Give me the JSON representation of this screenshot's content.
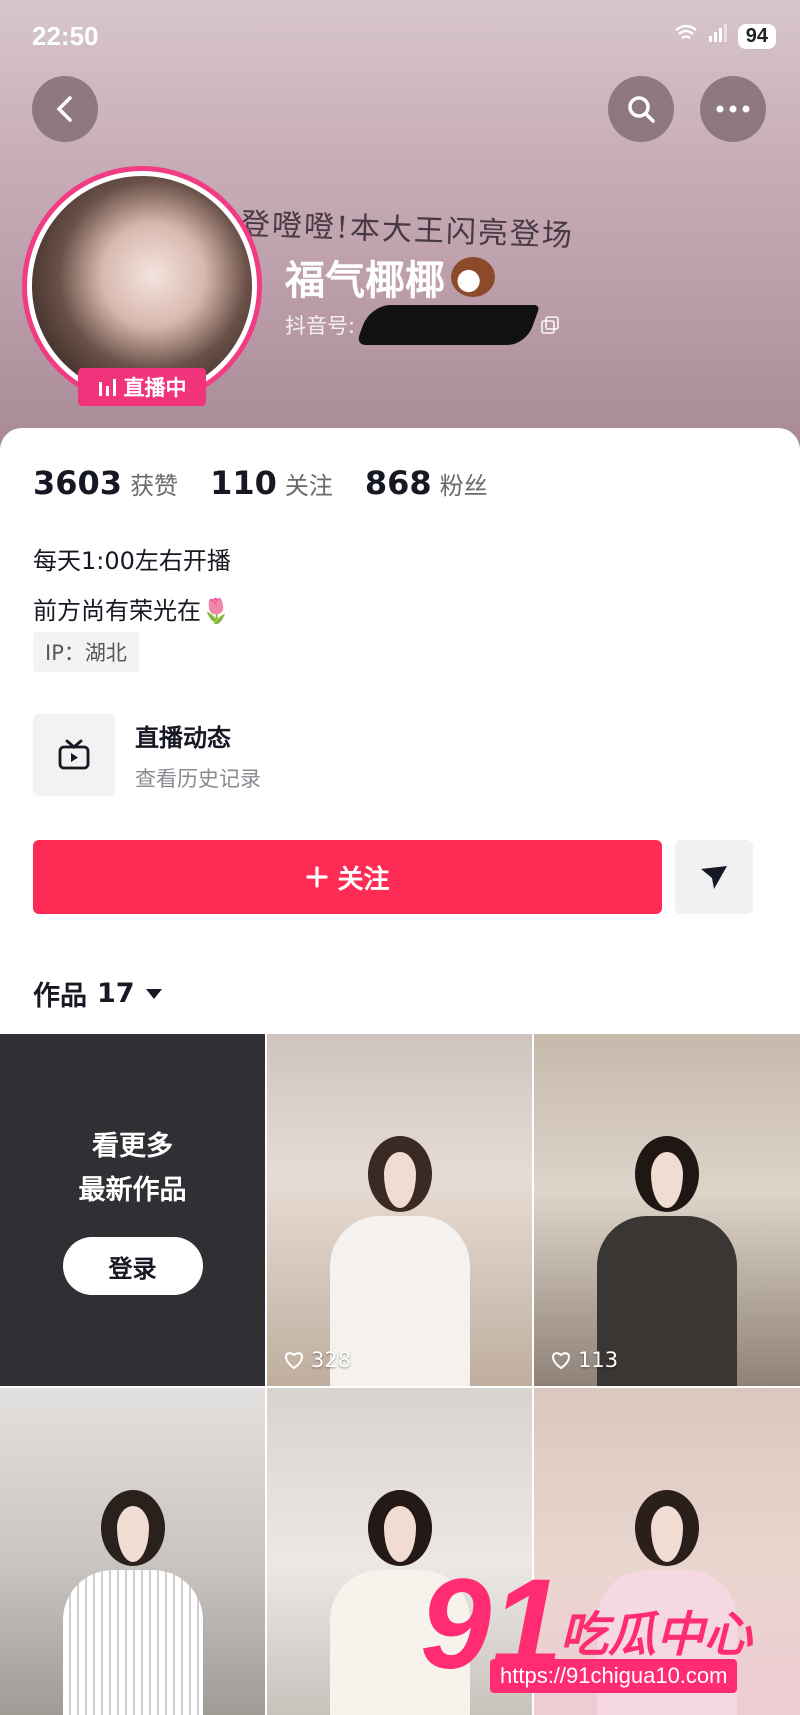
{
  "status_bar": {
    "time": "22:50",
    "battery": "94"
  },
  "header": {
    "scribble_text": "登噔噔!本大王闪亮登场",
    "nickname": "福气椰椰",
    "douyin_id_label": "抖音号:",
    "live_badge": "直播中"
  },
  "stats": [
    {
      "value": "3603",
      "label": "获赞"
    },
    {
      "value": "110",
      "label": "关注"
    },
    {
      "value": "868",
      "label": "粉丝"
    }
  ],
  "bio": {
    "line1": "每天1:00左右开播",
    "line2": "前方尚有荣光在🌷"
  },
  "ip": "IP：湖北",
  "live_section": {
    "title": "直播动态",
    "subtitle": "查看历史记录"
  },
  "actions": {
    "follow": "关注"
  },
  "works_tab": {
    "label": "作品",
    "count": "17"
  },
  "grid": {
    "more_line1": "看更多",
    "more_line2": "最新作品",
    "login": "登录",
    "likes": [
      "328",
      "113"
    ]
  },
  "watermark": {
    "number": "91",
    "text": "吃瓜中心",
    "url": "https://91chigua10.com"
  },
  "colors": {
    "accent": "#fe2c55",
    "live": "#f0337a",
    "watermark": "#ff2b73"
  }
}
